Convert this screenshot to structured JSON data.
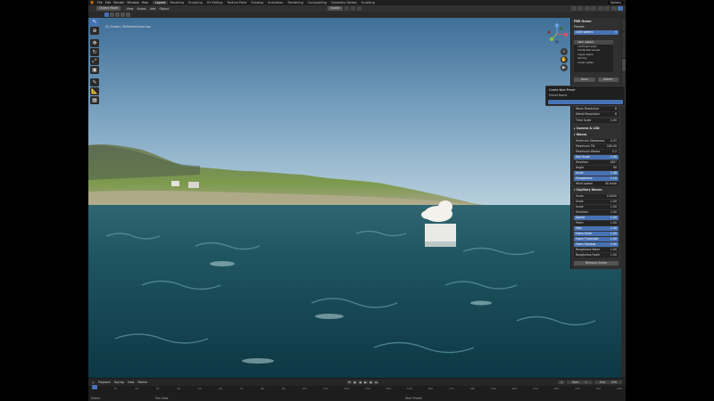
{
  "topbar": {
    "menus": [
      "File",
      "Edit",
      "Render",
      "Window",
      "Help"
    ],
    "workspaces": [
      {
        "label": "Layout",
        "active": true
      },
      {
        "label": "Modeling",
        "active": false
      },
      {
        "label": "Sculpting",
        "active": false
      },
      {
        "label": "UV Editing",
        "active": false
      },
      {
        "label": "Texture Paint",
        "active": false
      },
      {
        "label": "Shading",
        "active": false
      },
      {
        "label": "Animation",
        "active": false
      },
      {
        "label": "Rendering",
        "active": false
      },
      {
        "label": "Compositing",
        "active": false
      },
      {
        "label": "Geometry Nodes",
        "active": false
      },
      {
        "label": "Scripting",
        "active": false
      }
    ],
    "options_label": "Options"
  },
  "header": {
    "mode": "Object Mode",
    "menus": [
      "View",
      "Select",
      "Add",
      "Object"
    ],
    "transform_orientation": "Global"
  },
  "viewport": {
    "info_line1": "(5) Ocean | ReflectionColor.top",
    "info_line2": "User Perspective"
  },
  "toolbar": {
    "icons": [
      "cursor-select-icon",
      "cursor-3d-icon",
      "move-icon",
      "rotate-icon",
      "scale-icon",
      "transform-icon",
      "annotate-icon",
      "measure-icon",
      "add-cube-icon"
    ]
  },
  "gizmo": {
    "x": "X",
    "y": "Y",
    "z": "Z"
  },
  "panel": {
    "title": "PBR Ocean",
    "presets_label": "Presets",
    "preset_selected": "calm waters",
    "presets": [
      "calm waters",
      "confused seas",
      "moderate waves",
      "rogue wave",
      "stormy",
      "ocean glass"
    ],
    "save_button": "Save",
    "delete_button": "Delete",
    "wave_resolution": {
      "label": "Wave Resolution",
      "value": "8"
    },
    "detail_resolution": {
      "label": "Detail Resolution",
      "value": "8"
    },
    "time_scale": {
      "label": "Time Scale",
      "value": "1.00"
    },
    "camera_section": "Camera & LOD",
    "waves_section": "Waves",
    "waves": [
      {
        "label": "Minimum Steepness",
        "value": "0.25"
      },
      {
        "label": "Maximum Tilt",
        "value": "180.00"
      },
      {
        "label": "Maximum Waves",
        "value": "5.2"
      },
      {
        "label": "Sim Scale",
        "value": "1.00",
        "blue": true
      },
      {
        "label": "Direction",
        "value": "180°"
      },
      {
        "label": "Angle",
        "value": "90"
      },
      {
        "label": "Scale",
        "value": "1.48",
        "blue": true
      },
      {
        "label": "Choppiness",
        "value": "1.10",
        "blue": true
      },
      {
        "label": "Wind speed",
        "value": "30 km/h"
      }
    ],
    "capillary_section": "Capillary Waves",
    "capillary": [
      {
        "label": "Scale",
        "value": "0.0050"
      },
      {
        "label": "Scale",
        "value": "1.00"
      },
      {
        "label": "Scale",
        "value": "1.00"
      },
      {
        "label": "Direction",
        "value": "1.00"
      },
      {
        "label": "Speed",
        "value": "1.00",
        "blue": true
      },
      {
        "label": "Fetch",
        "value": "1.00"
      },
      {
        "label": "Gain",
        "value": "1.00",
        "blue": true
      },
      {
        "label": "Foam Scale",
        "value": "1.00",
        "blue": true
      },
      {
        "label": "Foam Threshold",
        "value": "1.00",
        "blue": true
      },
      {
        "label": "Foam Shadow",
        "value": "1.00",
        "blue": true
      },
      {
        "label": "Roughness Wave",
        "value": "1.00"
      },
      {
        "label": "Roughness Foam",
        "value": "1.00"
      }
    ],
    "remove_button": "Remove Ocean"
  },
  "popup": {
    "title": "Create New Preset",
    "subtitle": "Preset Name"
  },
  "timeline": {
    "menus": [
      "Playback",
      "Keying",
      "View",
      "Marker"
    ],
    "current_frame": "1",
    "start_label": "Start",
    "start_value": "1",
    "end_label": "End",
    "end_value": "250",
    "ticks": [
      "0",
      "10",
      "20",
      "30",
      "40",
      "50",
      "60",
      "70",
      "80",
      "90",
      "100",
      "110",
      "120",
      "130",
      "140",
      "150",
      "160",
      "170",
      "180",
      "190",
      "200",
      "210",
      "220",
      "230",
      "240",
      "250"
    ]
  },
  "status": {
    "left": "Select",
    "middle": "Pan View",
    "center": "Start Preset"
  }
}
